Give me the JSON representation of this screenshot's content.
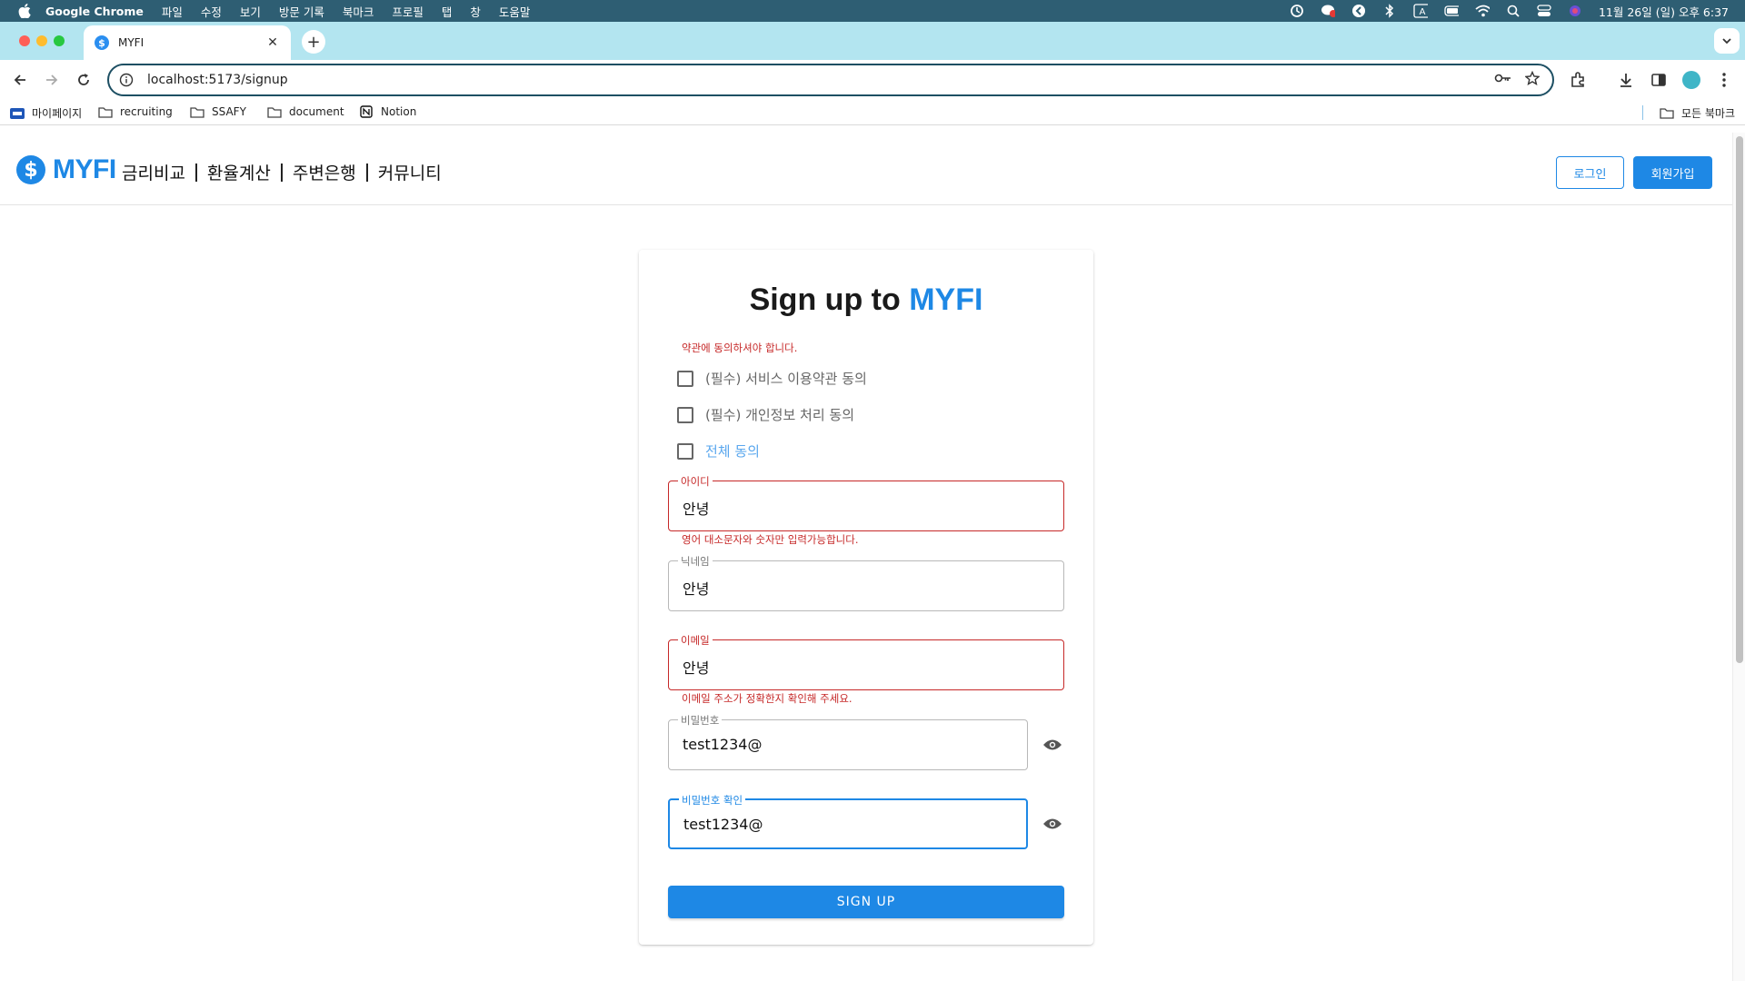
{
  "os_menubar": {
    "app_name": "Google Chrome",
    "menus": [
      "파일",
      "수정",
      "보기",
      "방문 기록",
      "북마크",
      "프로필",
      "탭",
      "창",
      "도움말"
    ],
    "clock": "11월 26일 (일) 오후 6:37",
    "tray_icons": [
      "sync-icon",
      "chat-icon",
      "vpn-icon",
      "bluetooth-icon",
      "input-source-icon",
      "battery-icon",
      "wifi-icon",
      "spotlight-icon",
      "control-center-icon",
      "siri-icon"
    ]
  },
  "browser": {
    "tab_title": "MYFI",
    "favicon": "$",
    "url": "localhost:5173/signup",
    "bookmarks": [
      {
        "label": "마이페이지",
        "icon": "site-icon"
      },
      {
        "label": "recruiting",
        "icon": "folder-icon"
      },
      {
        "label": "SSAFY",
        "icon": "folder-icon"
      },
      {
        "label": "document",
        "icon": "folder-icon"
      },
      {
        "label": "Notion",
        "icon": "notion-icon"
      }
    ],
    "all_bookmarks": "모든 북마크"
  },
  "site": {
    "logo_symbol": "$",
    "logo_text": "MYFI",
    "nav": [
      "금리비교",
      "환율계산",
      "주변은행",
      "커뮤니티"
    ],
    "login_label": "로그인",
    "signup_label": "회원가입",
    "accent_color": "#1e88e5"
  },
  "form": {
    "title_prefix": "Sign up to ",
    "title_brand": "MYFI",
    "terms_error": "약관에 동의하셔야 합니다.",
    "checkboxes": [
      {
        "label": "(필수) 서비스 이용약관 동의",
        "checked": false
      },
      {
        "label": "(필수) 개인정보 처리 동의",
        "checked": false
      },
      {
        "label": "전체 동의",
        "checked": false
      }
    ],
    "fields": {
      "username": {
        "label": "아이디",
        "value": "안녕",
        "error": "영어 대소문자와 숫자만 입력가능합니다."
      },
      "nickname": {
        "label": "닉네임",
        "value": "안녕"
      },
      "email": {
        "label": "이메일",
        "value": "안녕",
        "error": "이메일 주소가 정확한지 확인해 주세요."
      },
      "password": {
        "label": "비밀번호",
        "value": "test1234@"
      },
      "password_confirm": {
        "label": "비밀번호 확인",
        "value": "test1234@"
      }
    },
    "submit_label": "SIGN UP",
    "error_color": "#c62828"
  }
}
